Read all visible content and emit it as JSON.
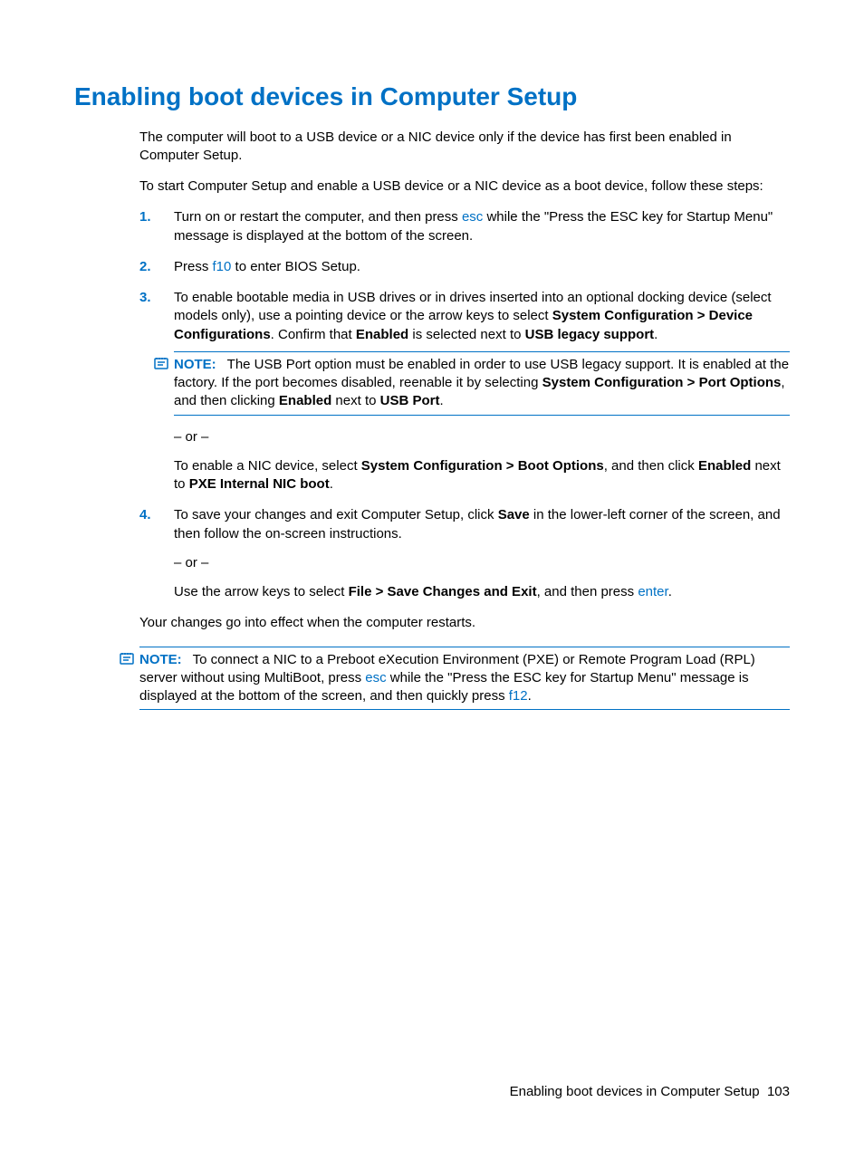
{
  "title": "Enabling boot devices in Computer Setup",
  "intro": {
    "p1": "The computer will boot to a USB device or a NIC device only if the device has first been enabled in Computer Setup.",
    "p2": "To start Computer Setup and enable a USB device or a NIC device as a boot device, follow these steps:"
  },
  "steps": {
    "s1a": "Turn on or restart the computer, and then press ",
    "s1_key": "esc",
    "s1b": " while the \"Press the ESC key for Startup Menu\" message is displayed at the bottom of the screen.",
    "s2a": "Press ",
    "s2_key": "f10",
    "s2b": " to enter BIOS Setup.",
    "s3a": "To enable bootable media in USB drives or in drives inserted into an optional docking device (select models only), use a pointing device or the arrow keys to select ",
    "s3_bold1": "System Configuration > Device Configurations",
    "s3b": ". Confirm that ",
    "s3_bold2": "Enabled",
    "s3c": " is selected next to ",
    "s3_bold3": "USB legacy support",
    "s3d": ".",
    "note1_label": "NOTE:",
    "note1a": "The USB Port option must be enabled in order to use USB legacy support. It is enabled at the factory. If the port becomes disabled, reenable it by selecting ",
    "note1_bold1": "System Configuration > Port Options",
    "note1b": ", and then clicking ",
    "note1_bold2": "Enabled",
    "note1c": " next to ",
    "note1_bold3": "USB Port",
    "note1d": ".",
    "or": "– or –",
    "s3_alt_a": "To enable a NIC device, select ",
    "s3_alt_bold1": "System Configuration > Boot Options",
    "s3_alt_b": ", and then click ",
    "s3_alt_bold2": "Enabled",
    "s3_alt_c": " next to ",
    "s3_alt_bold3": "PXE Internal NIC boot",
    "s3_alt_d": ".",
    "s4a": "To save your changes and exit Computer Setup, click ",
    "s4_bold1": "Save",
    "s4b": " in the lower-left corner of the screen, and then follow the on-screen instructions.",
    "s4_alt_a": "Use the arrow keys to select ",
    "s4_alt_bold1": "File > Save Changes and Exit",
    "s4_alt_b": ", and then press ",
    "s4_alt_key": "enter",
    "s4_alt_c": "."
  },
  "after": "Your changes go into effect when the computer restarts.",
  "footer_note": {
    "label": "NOTE:",
    "a": "To connect a NIC to a Preboot eXecution Environment (PXE) or Remote Program Load (RPL) server without using MultiBoot, press ",
    "key1": "esc",
    "b": " while the \"Press the ESC key for Startup Menu\" message is displayed at the bottom of the screen, and then quickly press ",
    "key2": "f12",
    "c": "."
  },
  "page_footer": {
    "section": "Enabling boot devices in Computer Setup",
    "page_no": "103"
  }
}
